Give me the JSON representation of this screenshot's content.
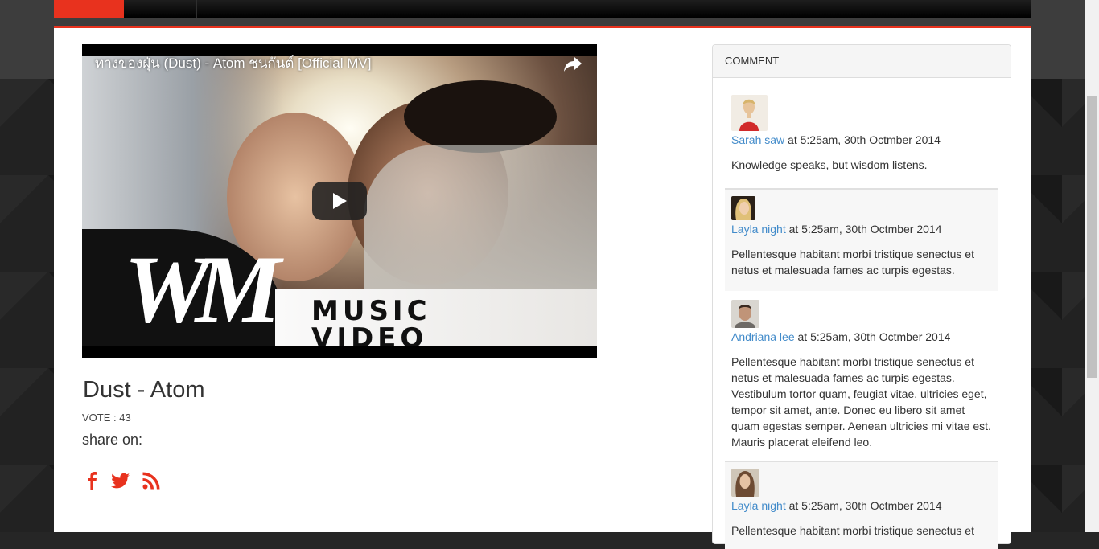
{
  "video": {
    "title": "ทางของฝุ่น (Dust) - Atom ชนกันต์ [Official MV]",
    "logo_text": "WM",
    "overlay_line1": "MUSIC",
    "overlay_line2": "VIDEO"
  },
  "song": {
    "title": "Dust  -  Atom",
    "vote": "VOTE : 43",
    "share_label": "share on:",
    "share_icons": [
      "facebook-icon",
      "twitter-icon",
      "rss-icon"
    ]
  },
  "comments": {
    "heading": "COMMENT",
    "items": [
      {
        "author": "Sarah saw",
        "time": " at 5:25am, 30th Octmber 2014",
        "text": "Knowledge speaks, but wisdom listens."
      },
      {
        "author": "Layla night",
        "time": " at 5:25am, 30th Octmber 2014",
        "text": "Pellentesque habitant morbi tristique senectus et netus et malesuada fames ac turpis egestas."
      },
      {
        "author": "Andriana lee",
        "time": " at 5:25am, 30th Octmber 2014",
        "text": "Pellentesque habitant morbi tristique senectus et netus et malesuada fames ac turpis egestas. Vestibulum tortor quam, feugiat vitae, ultricies eget, tempor sit amet, ante. Donec eu libero sit amet quam egestas semper. Aenean ultricies mi vitae est. Mauris placerat eleifend leo."
      },
      {
        "author": "Layla night",
        "time": " at 5:25am, 30th Octmber 2014",
        "text": "Pellentesque habitant morbi tristique senectus et"
      }
    ]
  },
  "colors": {
    "accent": "#e8321e",
    "link": "#428bca"
  }
}
